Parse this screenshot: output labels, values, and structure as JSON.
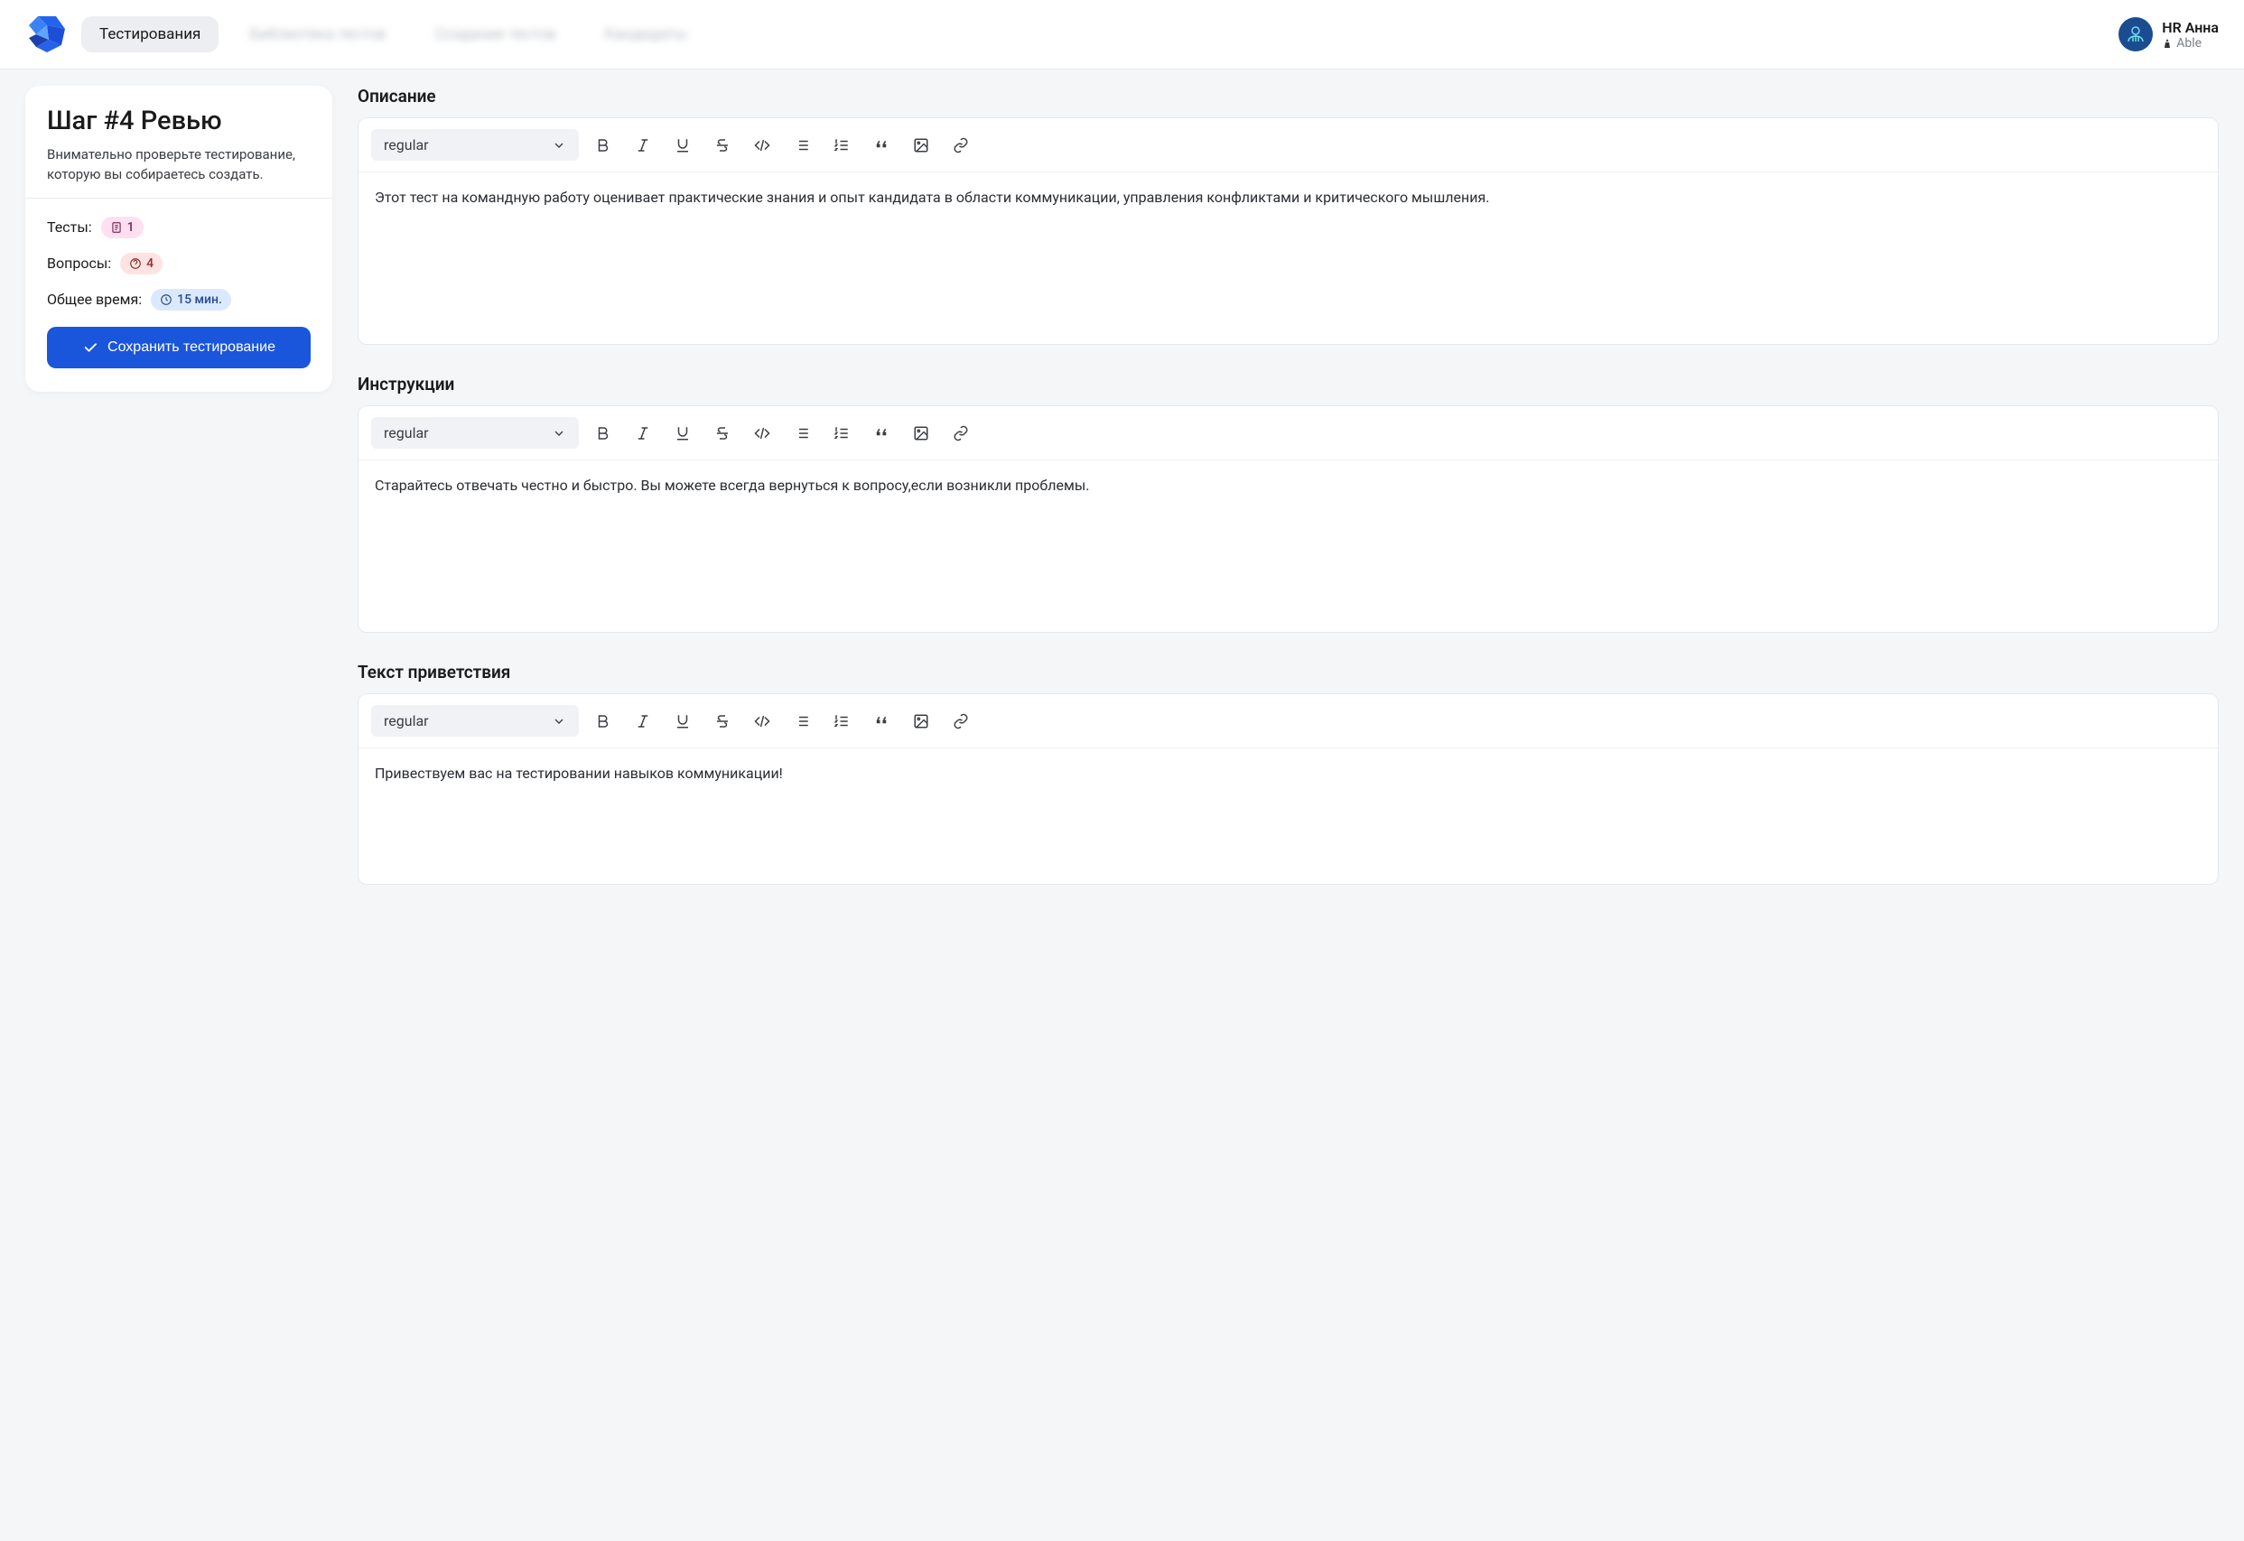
{
  "header": {
    "nav_active": "Тестирования",
    "nav_items": [
      "Библиотека тестов",
      "Создание тестов",
      "Кандидаты"
    ],
    "user_name": "HR Анна",
    "user_sub": "Able"
  },
  "sidebar": {
    "title": "Шаг #4 Ревью",
    "description": "Внимательно проверьте тестирование, которую вы собираетесь создать.",
    "stats": {
      "tests_label": "Тесты:",
      "tests_count": "1",
      "questions_label": "Вопросы:",
      "questions_count": "4",
      "time_label": "Общее время:",
      "time_value": "15 мин."
    },
    "save_label": "Сохранить тестирование"
  },
  "editors": {
    "dropdown_label": "regular",
    "description": {
      "title": "Описание",
      "content": "Этот тест на командную работу оценивает практические знания и опыт кандидата в области коммуникации, управления конфликтами и критического мышления."
    },
    "instructions": {
      "title": "Инструкции",
      "content": "Старайтесь отвечать честно и быстро. Вы можете всегда вернуться к вопросу,если возникли проблемы."
    },
    "greeting": {
      "title": "Текст приветствия",
      "content": "Привествуем вас на тестировании навыков коммуникации!"
    }
  }
}
